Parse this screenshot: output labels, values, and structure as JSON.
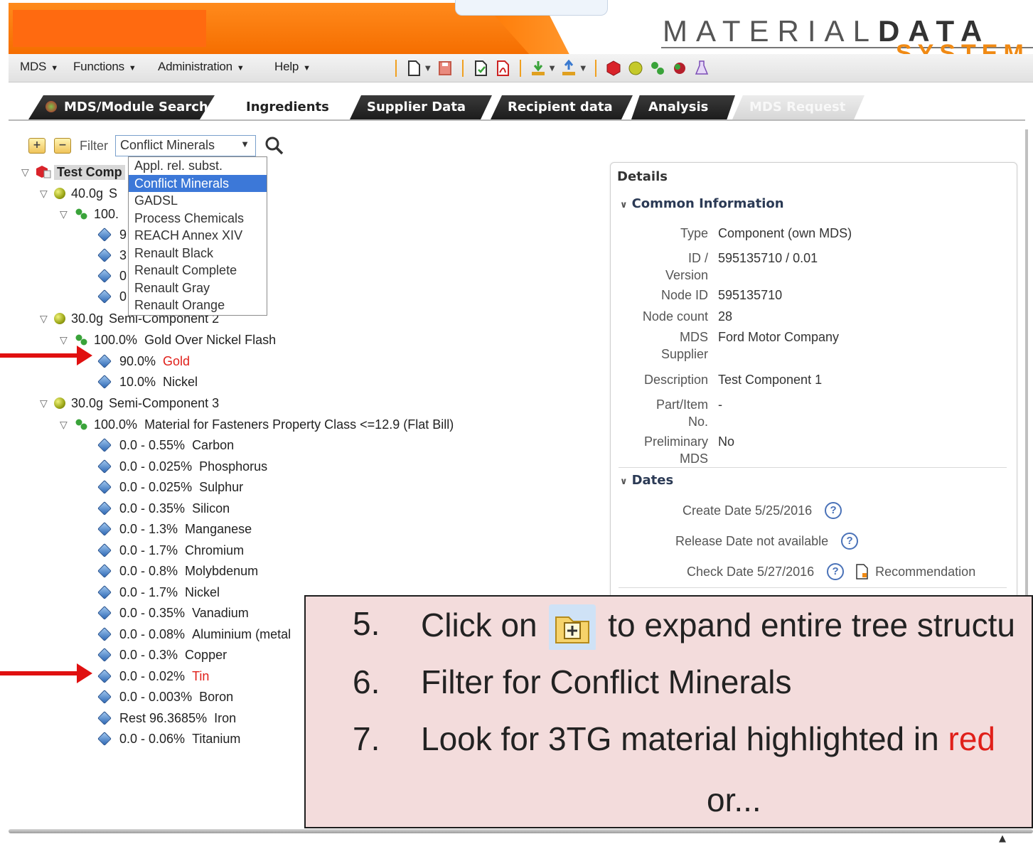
{
  "menu": {
    "items": [
      "MDS",
      "Functions",
      "Administration",
      "Help"
    ]
  },
  "brand": {
    "line1_light": "MATERIAL",
    "line1_bold": "DATA",
    "line2": "SYSTEM"
  },
  "tabs": [
    {
      "label": "MDS/Module Search",
      "state": "inactive"
    },
    {
      "label": "Ingredients",
      "state": "active"
    },
    {
      "label": "Supplier Data",
      "state": "inactive"
    },
    {
      "label": "Recipient data",
      "state": "inactive"
    },
    {
      "label": "Analysis",
      "state": "inactive"
    },
    {
      "label": "MDS Request",
      "state": "disabled"
    }
  ],
  "filter": {
    "label": "Filter",
    "selected": "Conflict Minerals",
    "options": [
      "Appl. rel. subst.",
      "Conflict Minerals",
      "GADSL",
      "Process Chemicals",
      "REACH Annex XIV",
      "Renault Black",
      "Renault Complete",
      "Renault Gray",
      "Renault Orange"
    ]
  },
  "tree": {
    "root": "Test Comp",
    "sc1": {
      "amount": "40.0g",
      "name": "S"
    },
    "sc1_mat": "100.",
    "sc1_subs": [
      "9",
      "3",
      "0",
      "0"
    ],
    "sc2": {
      "amount": "30.0g",
      "name": "Semi-Component 2"
    },
    "sc2_mat": {
      "pct": "100.0%",
      "name": "Gold Over Nickel Flash"
    },
    "sc2_subs": [
      {
        "pct": "90.0%",
        "name": "Gold",
        "conflict": true
      },
      {
        "pct": "10.0%",
        "name": "Nickel",
        "conflict": false
      }
    ],
    "sc3": {
      "amount": "30.0g",
      "name": "Semi-Component 3"
    },
    "sc3_mat": {
      "pct": "100.0%",
      "name": "Material for Fasteners Property Class <=12.9 (Flat Bill)"
    },
    "sc3_subs": [
      {
        "pct": "0.0 - 0.55%",
        "name": "Carbon",
        "conflict": false
      },
      {
        "pct": "0.0 - 0.025%",
        "name": "Phosphorus",
        "conflict": false
      },
      {
        "pct": "0.0 - 0.025%",
        "name": "Sulphur",
        "conflict": false
      },
      {
        "pct": "0.0 - 0.35%",
        "name": "Silicon",
        "conflict": false
      },
      {
        "pct": "0.0 - 1.3%",
        "name": "Manganese",
        "conflict": false
      },
      {
        "pct": "0.0 - 1.7%",
        "name": "Chromium",
        "conflict": false
      },
      {
        "pct": "0.0 - 0.8%",
        "name": "Molybdenum",
        "conflict": false
      },
      {
        "pct": "0.0 - 1.7%",
        "name": "Nickel",
        "conflict": false
      },
      {
        "pct": "0.0 - 0.35%",
        "name": "Vanadium",
        "conflict": false
      },
      {
        "pct": "0.0 - 0.08%",
        "name": "Aluminium (metal",
        "conflict": false
      },
      {
        "pct": "0.0 - 0.3%",
        "name": "Copper",
        "conflict": false
      },
      {
        "pct": "0.0 - 0.02%",
        "name": "Tin",
        "conflict": true
      },
      {
        "pct": "0.0 - 0.003%",
        "name": "Boron",
        "conflict": false
      },
      {
        "pct": "Rest 96.3685%",
        "name": "Iron",
        "conflict": false
      },
      {
        "pct": "0.0 - 0.06%",
        "name": "Titanium",
        "conflict": false
      }
    ]
  },
  "details": {
    "title": "Details",
    "common_header": "Common Information",
    "fields": {
      "type_label": "Type",
      "type_value": "Component (own MDS)",
      "id_label_1": "ID /",
      "id_label_2": "Version",
      "id_value": "595135710 / 0.01",
      "node_id_label": "Node ID",
      "node_id_value": "595135710",
      "node_count_label": "Node count",
      "node_count_value": "28",
      "supplier_label_1": "MDS",
      "supplier_label_2": "Supplier",
      "supplier_value": "Ford Motor Company",
      "desc_label": "Description",
      "desc_value": "Test Component 1",
      "part_label_1": "Part/Item",
      "part_label_2": "No.",
      "part_value": "-",
      "prelim_label_1": "Preliminary",
      "prelim_label_2": "MDS",
      "prelim_value": "No"
    },
    "dates_header": "Dates",
    "create_date": "Create Date 5/25/2016",
    "release_date": "Release Date not available",
    "check_date": "Check Date 5/27/2016",
    "recommendation": "Recommendation"
  },
  "callout": {
    "step5_num": "5.",
    "step5_pre": "Click on",
    "step5_post": "to expand entire tree structu",
    "step6_num": "6.",
    "step6_text": "Filter for Conflict Minerals",
    "step7_num": "7.",
    "step7_text": "Look for 3TG material highlighted in ",
    "step7_red": "red",
    "or_text": "or..."
  },
  "colors": {
    "header_orange": "#ff7a05",
    "conflict_red": "#e0201a",
    "callout_bg": "#f3dcdc",
    "selection_blue": "#3c78d8"
  }
}
